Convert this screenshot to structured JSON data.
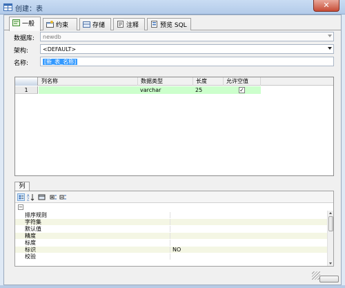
{
  "window": {
    "title": "创建：表",
    "close_label": "✕"
  },
  "tabs": [
    {
      "label": "一般",
      "icon": "general-icon"
    },
    {
      "label": "约束",
      "icon": "constraint-icon"
    },
    {
      "label": "存储",
      "icon": "storage-icon"
    },
    {
      "label": "注释",
      "icon": "comment-icon"
    },
    {
      "label": "预览 SQL",
      "icon": "preview-sql-icon"
    }
  ],
  "form": {
    "database_label": "数据库:",
    "database_value": "newdb",
    "schema_label": "架构:",
    "schema_value": "<DEFAULT>",
    "name_label": "名称:",
    "name_value": "[新_表_名称]"
  },
  "columns_grid": {
    "headers": [
      "列名称",
      "数据类型",
      "长度",
      "允许空值"
    ],
    "rows": [
      {
        "index": "1",
        "name": "",
        "type": "varchar",
        "length": "25",
        "nullable": true
      }
    ]
  },
  "properties": {
    "tab_label": "列",
    "toolbar_icons": [
      "categorized-icon",
      "sort-az-icon",
      "property-pages-icon",
      "expand-icon",
      "collapse-icon"
    ],
    "rows": [
      {
        "name": "排序规则",
        "value": ""
      },
      {
        "name": "字符集",
        "value": ""
      },
      {
        "name": "默认值",
        "value": ""
      },
      {
        "name": "精度",
        "value": ""
      },
      {
        "name": "标度",
        "value": ""
      },
      {
        "name": "标识",
        "value": "NO"
      },
      {
        "name": "校验",
        "value": ""
      }
    ]
  },
  "colors": {
    "accent": "#3399ff",
    "row_highlight": "#ccffcc",
    "title_bar": "#c9dcf3"
  }
}
